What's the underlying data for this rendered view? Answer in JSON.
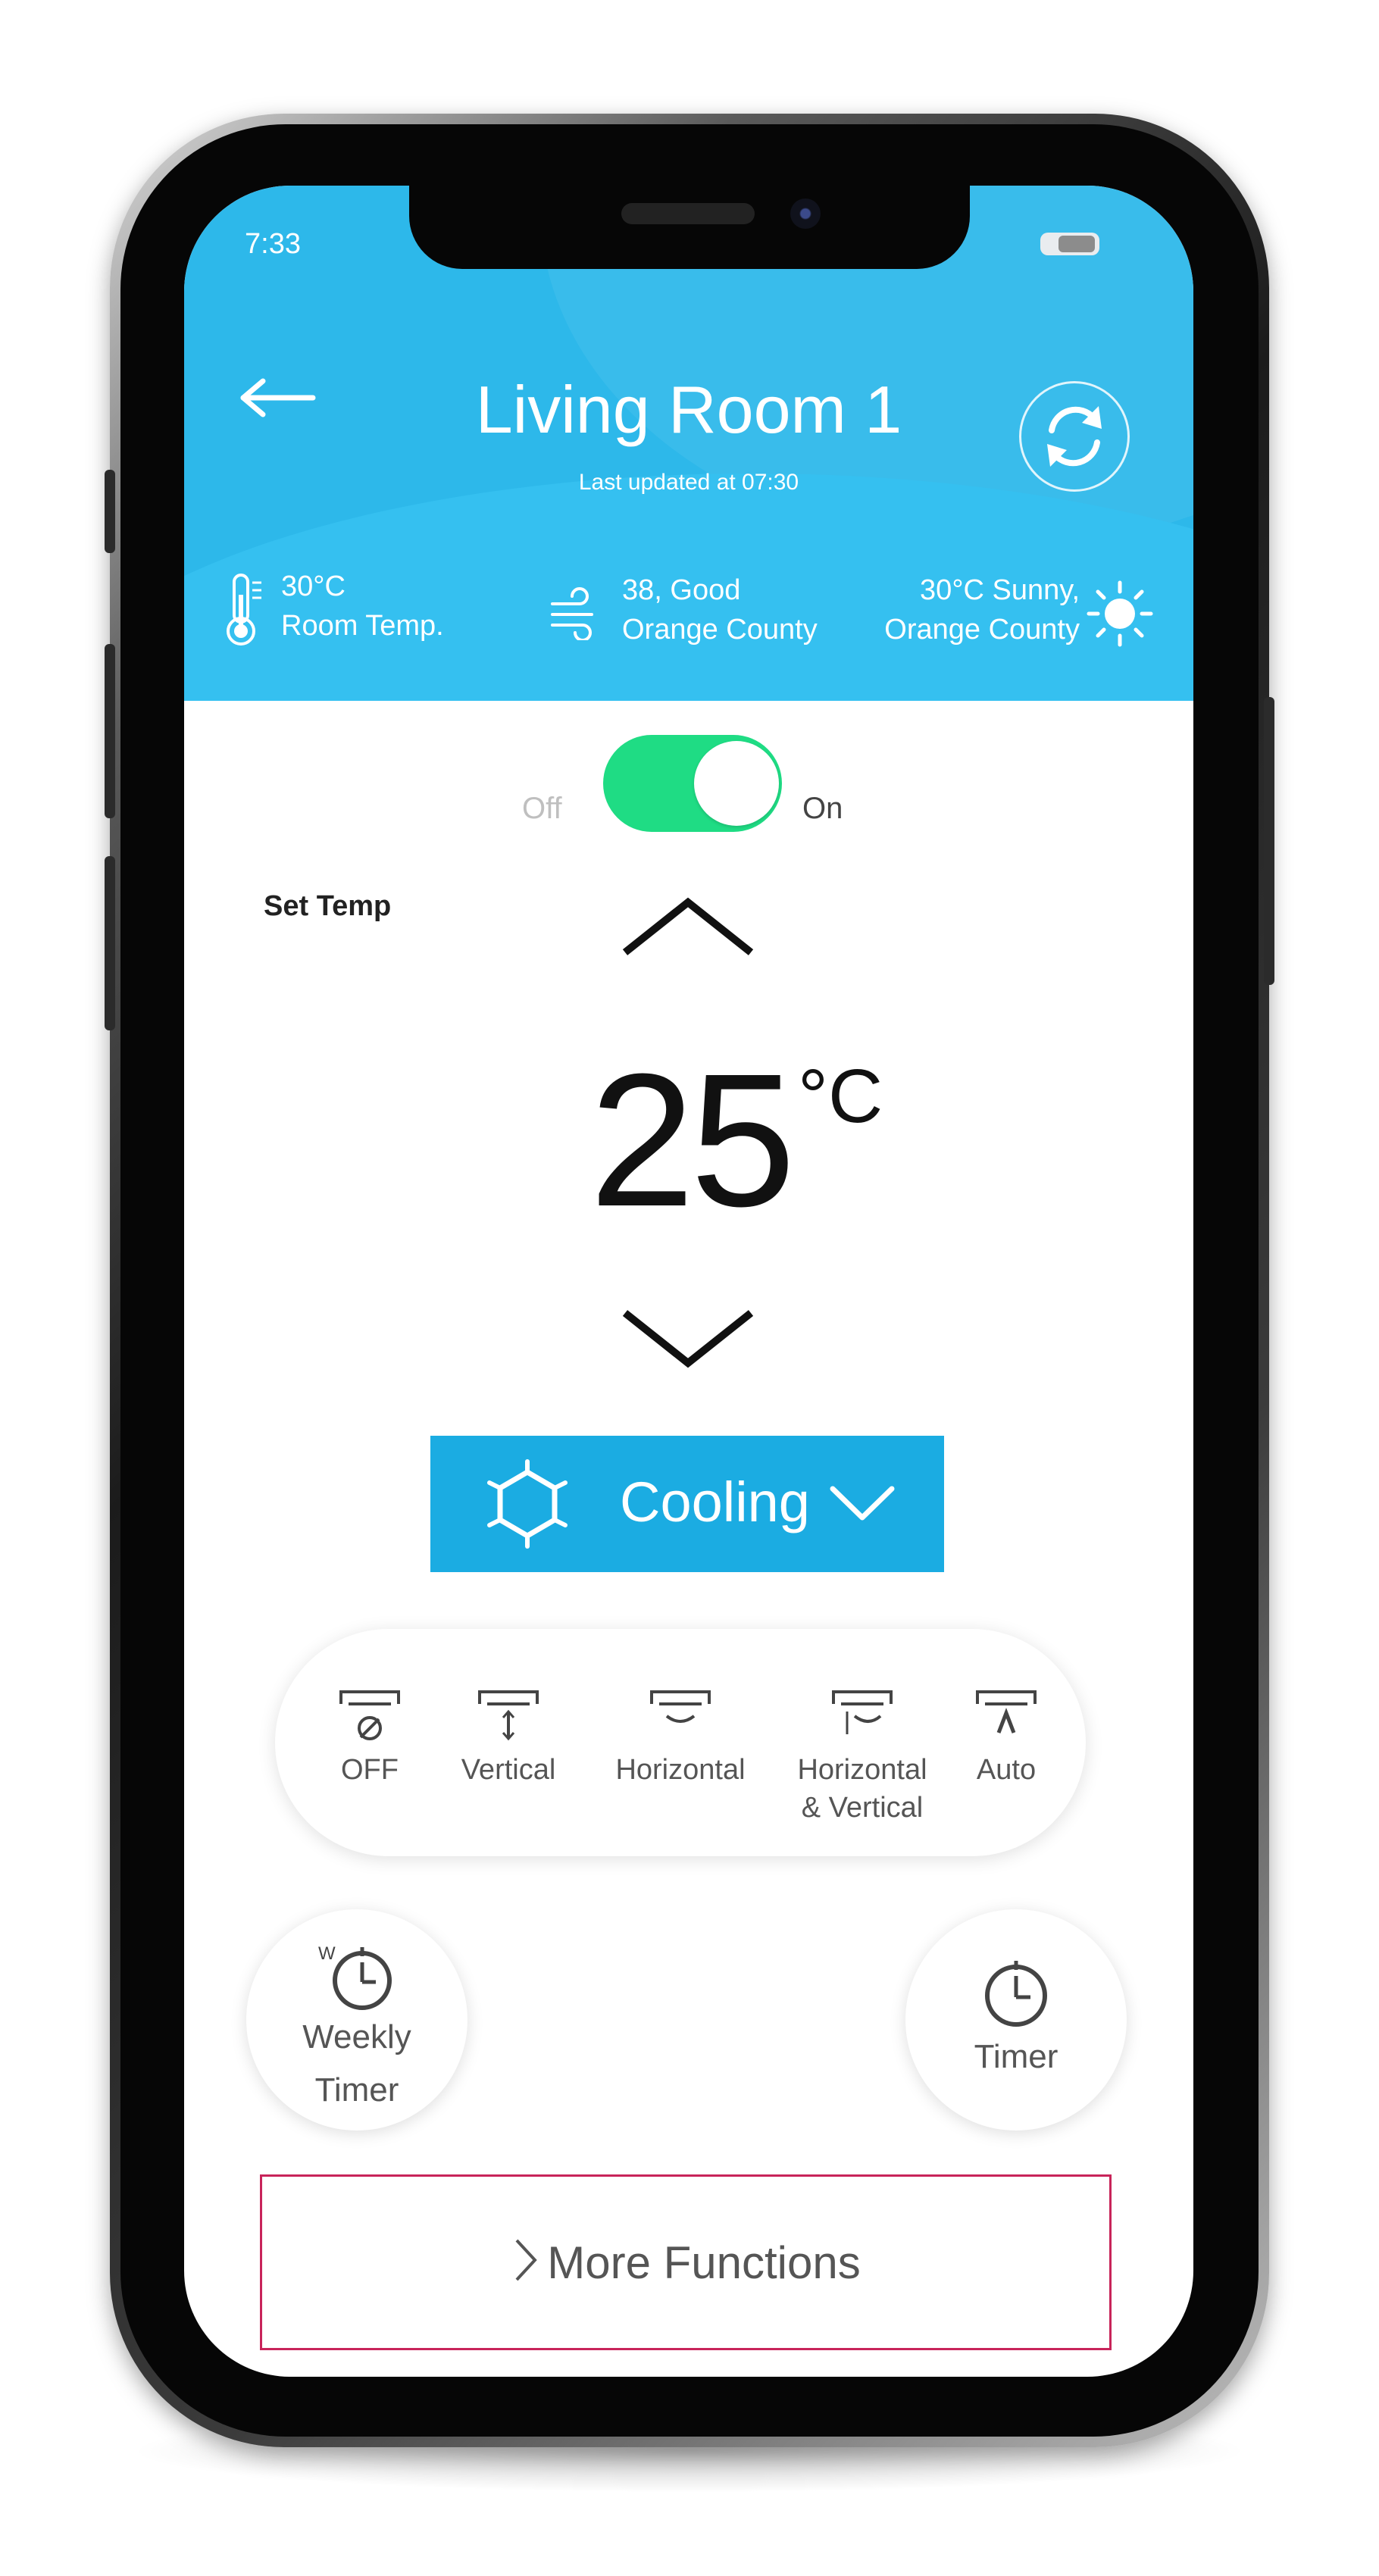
{
  "status_bar": {
    "time": "7:33"
  },
  "header": {
    "title": "Living Room 1",
    "subtitle": "Last updated at 07:30"
  },
  "info": {
    "room_temp_value": "30°C",
    "room_temp_label": "Room Temp.",
    "air_quality_value": "38, Good",
    "air_quality_location": "Orange County",
    "weather_value": "30°C Sunny,",
    "weather_location": "Orange County"
  },
  "power": {
    "off_label": "Off",
    "on_label": "On",
    "state": "on"
  },
  "temperature": {
    "label": "Set Temp",
    "value": "25",
    "unit": "°C"
  },
  "mode": {
    "label": "Cooling"
  },
  "swing": {
    "items": [
      {
        "label": "OFF"
      },
      {
        "label": "Vertical"
      },
      {
        "label": "Horizontal"
      },
      {
        "label_line1": "Horizontal",
        "label_line2": "& Vertical"
      },
      {
        "label": "Auto"
      }
    ]
  },
  "timers": {
    "weekly_line1": "Weekly",
    "weekly_line2": "Timer",
    "weekly_badge": "W",
    "timer_label": "Timer"
  },
  "more": {
    "label": "More Functions"
  },
  "colors": {
    "header_blue": "#2db8ea",
    "mode_blue": "#1bace2",
    "toggle_green": "#1fdc84",
    "more_border": "#c8245a"
  },
  "icons": [
    "back-arrow-icon",
    "refresh-icon",
    "thermometer-icon",
    "wind-icon",
    "sun-icon",
    "chevron-up-icon",
    "chevron-down-icon",
    "snowflake-icon",
    "dropdown-chevron-icon",
    "swing-off-icon",
    "swing-vertical-icon",
    "swing-horizontal-icon",
    "swing-both-icon",
    "swing-auto-icon",
    "weekly-clock-icon",
    "clock-icon",
    "chevron-right-icon"
  ]
}
